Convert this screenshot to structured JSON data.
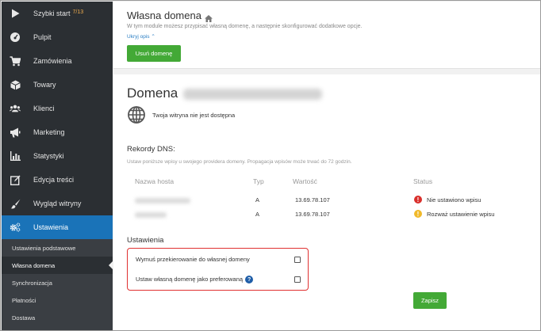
{
  "sidebar": {
    "items": [
      {
        "label": "Szybki start",
        "badge": "7/13",
        "icon": "play-icon"
      },
      {
        "label": "Pulpit",
        "icon": "dashboard-icon"
      },
      {
        "label": "Zamówienia",
        "icon": "cart-icon"
      },
      {
        "label": "Towary",
        "icon": "box-icon"
      },
      {
        "label": "Klienci",
        "icon": "users-icon"
      },
      {
        "label": "Marketing",
        "icon": "megaphone-icon"
      },
      {
        "label": "Statystyki",
        "icon": "chart-icon"
      },
      {
        "label": "Edycja treści",
        "icon": "edit-icon"
      },
      {
        "label": "Wygląd witryny",
        "icon": "brush-icon"
      },
      {
        "label": "Ustawienia",
        "icon": "gears-icon",
        "active": true
      }
    ],
    "submenu": [
      {
        "label": "Ustawienia podstawowe"
      },
      {
        "label": "Własna domena",
        "active": true
      },
      {
        "label": "Synchronizacja"
      },
      {
        "label": "Płatności"
      },
      {
        "label": "Dostawa"
      }
    ],
    "colors": {
      "background": "#2b2f33",
      "active": "#1a73b8",
      "badge": "#f0ad4e"
    }
  },
  "header": {
    "title": "Własna domena",
    "subtitle": "W tym module możesz przypisać własną domenę, a następnie skonfigurować dodatkowe opcje.",
    "hide_link": "Ukryj opis",
    "remove_button": "Usuń domenę"
  },
  "domain": {
    "heading": "Domena",
    "status": "Twoja witryna nie jest dostępna"
  },
  "dns": {
    "title": "Rekordy DNS:",
    "description": "Ustaw poniższe wpisy u swojego providera domeny. Propagacja wpisów może trwać do 72 godzin.",
    "columns": [
      "Nazwa hosta",
      "Typ",
      "Wartość",
      "Status"
    ],
    "rows": [
      {
        "type": "A",
        "value": "13.69.78.107",
        "status": "Nie ustawiono wpisu",
        "status_icon": "error-icon",
        "status_color": "#d9302c"
      },
      {
        "type": "A",
        "value": "13.69.78.107",
        "status": "Rozważ ustawienie wpisu",
        "status_icon": "warning-icon",
        "status_color": "#f0b92a"
      }
    ]
  },
  "settings": {
    "title": "Ustawienia",
    "options": [
      {
        "label": "Wymuś przekierowanie do własnej domeny",
        "checked": false
      },
      {
        "label": "Ustaw własną domenę jako preferowaną",
        "checked": false,
        "help": "?"
      }
    ],
    "save_button": "Zapisz"
  },
  "colors": {
    "accent_green": "#43a936",
    "highlight_red": "#e03131",
    "link_blue": "#2a7ec3"
  }
}
